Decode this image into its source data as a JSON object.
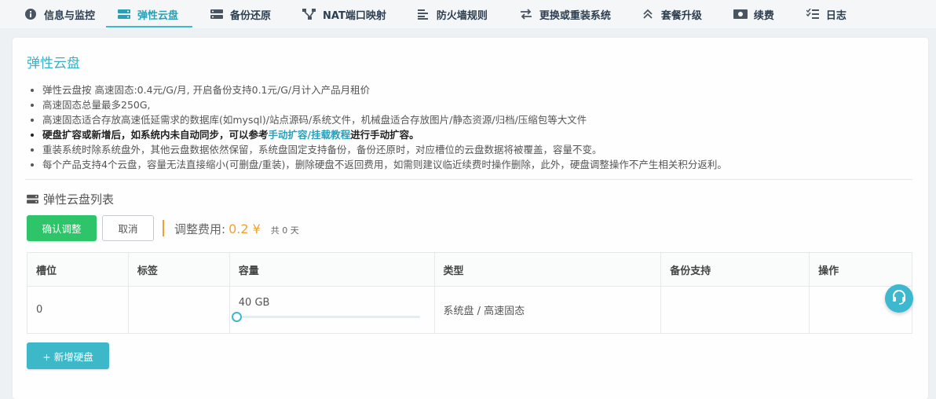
{
  "nav": [
    {
      "label": "信息与监控",
      "icon": "info-icon"
    },
    {
      "label": "弹性云盘",
      "icon": "disk-icon",
      "active": true
    },
    {
      "label": "备份还原",
      "icon": "server-icon"
    },
    {
      "label": "NAT端口映射",
      "icon": "network-icon"
    },
    {
      "label": "防火墙规则",
      "icon": "list-icon"
    },
    {
      "label": "更换或重装系统",
      "icon": "swap-icon"
    },
    {
      "label": "套餐升级",
      "icon": "upgrade-icon"
    },
    {
      "label": "续费",
      "icon": "money-icon"
    },
    {
      "label": "日志",
      "icon": "checklist-icon"
    }
  ],
  "panel": {
    "title": "弹性云盘",
    "notes": [
      "弹性云盘按 高速固态:0.4元/G/月, 开启备份支持0.1元/G/月计入产品月租价",
      "高速固态总量最多250G,",
      "高速固态适合存放高速低延需求的数据库(如mysql)/站点源码/系统文件，机械盘适合存放图片/静态资源/归档/压缩包等大文件",
      "重装系统时除系统盘外，其他云盘数据依然保留，系统盘固定支持备份，备份还原时，对应槽位的云盘数据将被覆盖，容量不变。",
      "每个产品支持4个云盘，容量无法直接缩小(可删盘/重装)，删除硬盘不返回费用，如需则建议临近续费时操作删除，此外，硬盘调整操作不产生相关积分返利。"
    ],
    "bold_note": {
      "prefix": "硬盘扩容或新增后，如系统内未自动同步，可以参考",
      "link1": "手动扩容",
      "sep": "/",
      "link2": "挂载教程",
      "suffix": "进行手动扩容。"
    }
  },
  "list": {
    "title": "弹性云盘列表",
    "confirm_label": "确认调整",
    "cancel_label": "取消",
    "fee_label": "调整费用:",
    "fee_amount": "0.2 ¥",
    "fee_days": "共 0 天",
    "columns": [
      "槽位",
      "标签",
      "容量",
      "类型",
      "备份支持",
      "操作"
    ],
    "rows": [
      {
        "slot": "0",
        "tag": "",
        "capacity": "40 GB",
        "capacity_fraction": 0.0,
        "type": "系统盘 / 高速固态",
        "backup": "",
        "action": ""
      }
    ],
    "add_label": "+ 新增硬盘"
  },
  "colors": {
    "accent": "#3cb8cf",
    "confirm": "#2ec469",
    "fee": "#f0a030"
  }
}
